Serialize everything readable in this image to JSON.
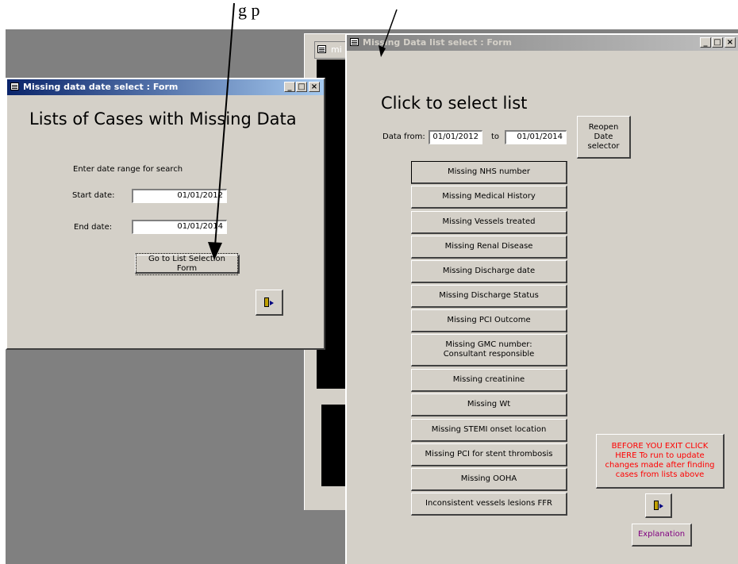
{
  "caption": {
    "text": "g p"
  },
  "bg_window": {
    "title_fragment": "mi"
  },
  "date_form": {
    "title": "Missing data date select : Form",
    "heading": "Lists of Cases with Missing Data",
    "instruction": "Enter date range for search",
    "start_label": "Start date:",
    "start_value": "01/01/2012",
    "end_label": "End date:",
    "end_value": "01/01/2014",
    "go_button": "Go to List Selection Form",
    "exit_icon": "exit-door-icon"
  },
  "list_form": {
    "title": "Missing Data list select : Form",
    "heading": "Click to select list",
    "data_from_label": "Data from:",
    "from_value": "01/01/2012",
    "to_label": "to",
    "to_value": "01/01/2014",
    "reopen_button": "Reopen Date selector",
    "list_buttons": [
      "Missing NHS number",
      "Missing Medical History",
      "Missing Vessels treated",
      "Missing Renal Disease",
      "Missing Discharge date",
      "Missing Discharge Status",
      "Missing PCI Outcome",
      "Missing GMC number: Consultant responsible",
      "Missing creatinine",
      "Missing Wt",
      "Missing STEMI onset location",
      "Missing PCI for stent thrombosis",
      "Missing OOHA",
      "Inconsistent vessels lesions FFR"
    ],
    "exit_note_button": "BEFORE YOU EXIT CLICK HERE To run to update changes made after finding cases from lists above",
    "explanation_button": "Explanation",
    "exit_icon": "exit-door-icon"
  },
  "colors": {
    "warning_text": "#ff0000",
    "explanation_text": "#800080",
    "title_active": "#0a246a"
  }
}
